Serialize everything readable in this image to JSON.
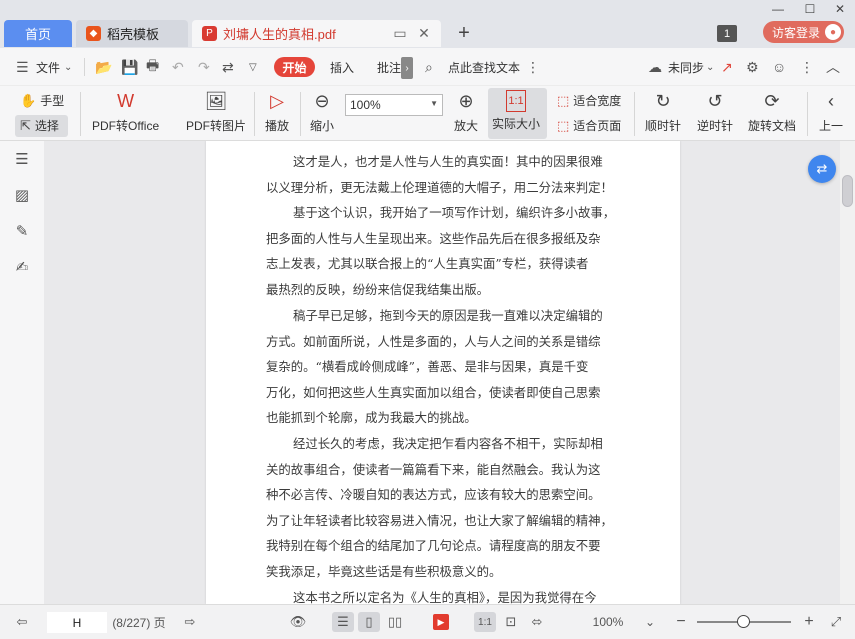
{
  "tabs": {
    "home": "首页",
    "template": "稻壳模板",
    "document": "刘墉人生的真相.pdf"
  },
  "header": {
    "page_count_badge": "1",
    "visitor_login": "访客登录"
  },
  "menu": {
    "file": "文件",
    "start": "开始",
    "insert": "插入",
    "annotate": "批注",
    "search_text": "点此查找文本",
    "sync": "未同步"
  },
  "ribbon": {
    "hand": "手型",
    "select": "选择",
    "pdf_to_office": "PDF转Office",
    "pdf_to_image": "PDF转图片",
    "play": "播放",
    "zoom_out": "缩小",
    "zoom_value": "100%",
    "zoom_in": "放大",
    "actual_size": "实际大小",
    "fit_width": "适合宽度",
    "fit_page": "适合页面",
    "clockwise": "顺时针",
    "counterclockwise": "逆时针",
    "rotate_doc": "旋转文档",
    "prev": "上一"
  },
  "document": {
    "paragraphs": [
      {
        "lines": [
          "这才是人，也才是人性与人生的真实面！其中的因果很难",
          "以义理分析，更无法戴上伦理道德的大帽子，用二分法来判定！"
        ]
      },
      {
        "lines": [
          "基于这个认识，我开始了一项写作计划，编织许多小故事，",
          "把多面的人性与人生呈现出来。这些作品先后在很多报纸及杂",
          "志上发表，尤其以联合报上的“人生真实面”专栏，获得读者",
          "最热烈的反映，纷纷来信促我结集出版。"
        ]
      },
      {
        "lines": [
          "稿子早已足够，拖到今天的原因是我一直难以决定编辑的",
          "方式。如前面所说，人性是多面的，人与人之间的关系是错综",
          "复杂的。“横看成岭侧成峰”，善恶、是非与因果，真是千变",
          "万化，如何把这些人生真实面加以组合，使读者即使自己思索",
          "也能抓到个轮廓，成为我最大的挑战。"
        ]
      },
      {
        "lines": [
          "经过长久的考虑，我决定把乍看内容各不相干，实际却相",
          "关的故事组合，使读者一篇篇看下来，能自然融会。我认为这",
          "种不必言传、冷暖自知的表达方式，应该有较大的思索空间。",
          "为了让年轻读者比较容易进入情况，也让大家了解编辑的精神，",
          "我特别在每个组合的结尾加了几句论点。请程度高的朋友不要",
          "笑我添足，毕竟这些话是有些积极意义的。"
        ]
      },
      {
        "lines": [
          "这本书之所以定名为《人生的真相》，是因为我觉得在今"
        ]
      }
    ]
  },
  "status": {
    "page_input": "H",
    "page_info": "(8/227) 页",
    "zoom_value": "100%"
  }
}
